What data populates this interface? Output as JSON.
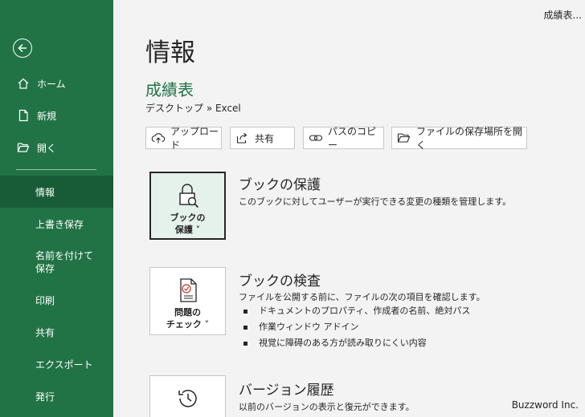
{
  "window": {
    "title": "成績表..."
  },
  "sidebar": {
    "back_icon": "arrow-left-circle-icon",
    "top_items": [
      {
        "label": "ホーム",
        "icon": "home-icon"
      },
      {
        "label": "新規",
        "icon": "new-file-icon"
      },
      {
        "label": "開く",
        "icon": "folder-open-icon"
      }
    ],
    "lower_items": [
      {
        "label": "情報",
        "active": true
      },
      {
        "label": "上書き保存"
      },
      {
        "label": "名前を付けて保存"
      },
      {
        "label": "印刷"
      },
      {
        "label": "共有"
      },
      {
        "label": "エクスポート"
      },
      {
        "label": "発行"
      }
    ]
  },
  "main": {
    "title": "情報",
    "doc_name": "成績表",
    "doc_path": "デスクトップ » Excel",
    "toolbar": [
      {
        "label": "アップロード",
        "icon": "cloud-upload-icon"
      },
      {
        "label": "共有",
        "icon": "share-icon"
      },
      {
        "label": "パスのコピー",
        "icon": "link-icon"
      },
      {
        "label": "ファイルの保存場所を開く",
        "icon": "folder-icon"
      }
    ],
    "sections": [
      {
        "card_line1": "ブックの",
        "card_line2": "保護 ˅",
        "icon": "lock-search-icon",
        "title": "ブックの保護",
        "desc": "このブックに対してユーザーが実行できる変更の種類を管理します。"
      },
      {
        "card_line1": "問題の",
        "card_line2": "チェック ˅",
        "icon": "document-check-icon",
        "title": "ブックの検査",
        "desc": "ファイルを公開する前に、ファイルの次の項目を確認します。",
        "bullets": [
          "ドキュメントのプロパティ、作成者の名前、絶対パス",
          "作業ウィンドウ アドイン",
          "視覚に障碍のある方が読み取りにくい内容"
        ]
      },
      {
        "icon": "history-clock-icon",
        "title": "バージョン履歴",
        "desc": "以前のバージョンの表示と復元ができます。"
      }
    ]
  },
  "watermark": "Buzzword Inc.",
  "colors": {
    "brand": "#217346",
    "active": "#185c37",
    "background": "#f3f3f3"
  }
}
